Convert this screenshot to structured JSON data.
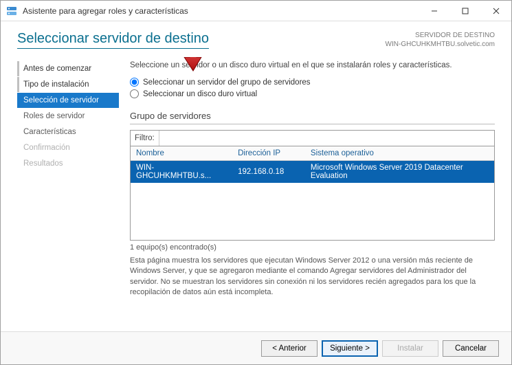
{
  "window": {
    "title": "Asistente para agregar roles y características"
  },
  "header": {
    "page_title": "Seleccionar servidor de destino",
    "dest_label": "SERVIDOR DE DESTINO",
    "dest_value": "WIN-GHCUHKMHTBU.solvetic.com"
  },
  "sidebar": {
    "steps": [
      {
        "label": "Antes de comenzar",
        "state": "completed"
      },
      {
        "label": "Tipo de instalación",
        "state": "completed"
      },
      {
        "label": "Selección de servidor",
        "state": "active"
      },
      {
        "label": "Roles de servidor",
        "state": "enabled"
      },
      {
        "label": "Características",
        "state": "enabled"
      },
      {
        "label": "Confirmación",
        "state": "disabled"
      },
      {
        "label": "Resultados",
        "state": "disabled"
      }
    ]
  },
  "main": {
    "instruction": "Seleccione un servidor o un disco duro virtual en el que se instalarán roles y características.",
    "radios": {
      "opt_pool": "Seleccionar un servidor del grupo de servidores",
      "opt_vhd": "Seleccionar un disco duro virtual",
      "selected": "opt_pool"
    },
    "group_legend": "Grupo de servidores",
    "filter_label": "Filtro:",
    "filter_value": "",
    "columns": {
      "name": "Nombre",
      "ip": "Dirección IP",
      "os": "Sistema operativo"
    },
    "rows": [
      {
        "name": "WIN-GHCUHKMHTBU.s...",
        "ip": "192.168.0.18",
        "os": "Microsoft Windows Server 2019 Datacenter Evaluation"
      }
    ],
    "count_text": "1 equipo(s) encontrado(s)",
    "description": "Esta página muestra los servidores que ejecutan Windows Server 2012 o una versión más reciente de Windows Server, y que se agregaron mediante el comando Agregar servidores del Administrador del servidor. No se muestran los servidores sin conexión ni los servidores recién agregados para los que la recopilación de datos aún está incompleta."
  },
  "footer": {
    "prev": "< Anterior",
    "next": "Siguiente >",
    "install": "Instalar",
    "cancel": "Cancelar"
  },
  "icons": {
    "app": "server-manager-icon",
    "minimize": "minimize-icon",
    "maximize": "maximize-icon",
    "close": "close-icon",
    "annotation": "red-arrow-down-icon"
  }
}
